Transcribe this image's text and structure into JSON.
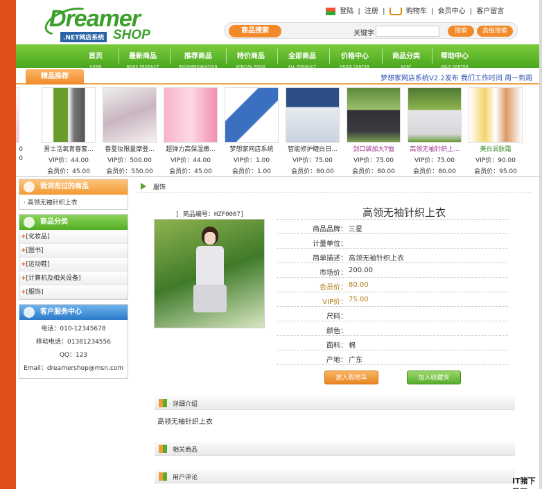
{
  "brand": {
    "main": "Dreamer",
    "sub1": ".NET网店系统",
    "sub2": "SHOP"
  },
  "toplinks": {
    "login": "登陆",
    "sep1": "|",
    "register": "注册",
    "sep2": "|",
    "cart": "购物车",
    "sep3": "|",
    "member": "会员中心",
    "sep4": "|",
    "guestbook": "客户留言"
  },
  "search": {
    "title": "商品搜索",
    "keyword_label": "关键字",
    "keyword_value": "",
    "search_btn": "搜索",
    "advanced_btn": "高级搜索"
  },
  "nav": [
    {
      "cn": "首页",
      "en": "HOME"
    },
    {
      "cn": "最新商品",
      "en": "NEWS PRODUCT"
    },
    {
      "cn": "推荐商品",
      "en": "RECOMMENDATION"
    },
    {
      "cn": "特价商品",
      "en": "SPECIAL PRICE"
    },
    {
      "cn": "全部商品",
      "en": "ALL PRODUCT"
    },
    {
      "cn": "价格中心",
      "en": "PRICE CENTER"
    },
    {
      "cn": "商品分类",
      "en": "SORT"
    },
    {
      "cn": "帮助中心",
      "en": "HELP CENTER"
    }
  ],
  "recommend": {
    "tab": "精品推荐",
    "marquee": "梦想家网店系统V2.2发布    我们工作时间  周一到周"
  },
  "products": [
    {
      "name": "",
      "vip": "0",
      "mem": "0"
    },
    {
      "name": "男士活氧青春套...",
      "vip": "VIP价：44.00",
      "mem": "会员价：45.00"
    },
    {
      "name": "春夏妆限量摩登...",
      "vip": "VIP价：500.00",
      "mem": "会员价：550.00"
    },
    {
      "name": "超弹力高保湿嫩...",
      "vip": "VIP价：44.00",
      "mem": "会员价：45.00"
    },
    {
      "name": "梦想家网店系统",
      "vip": "VIP价：1.00",
      "mem": "会员价：1.00"
    },
    {
      "name": "智能修护睫白日...",
      "vip": "VIP价：75.00",
      "mem": "会员价：80.00"
    },
    {
      "name": "剑口袋加大T恤",
      "vip": "VIP价：75.00",
      "mem": "会员价：80.00"
    },
    {
      "name": "高领无袖针织上...",
      "vip": "VIP价：75.00",
      "mem": "会员价：80.00"
    },
    {
      "name": "美白润肤霜",
      "vip": "VIP价：90.00",
      "mem": "会员价：95.00"
    }
  ],
  "sidebar": {
    "viewed_title": "我浏览过的商品",
    "viewed_item": "· 高领无袖针织上衣",
    "cat_title": "商品分类",
    "cats": [
      "[化妆品]",
      "[图书]",
      "[运动鞋]",
      "[计算机及相关设备]",
      "[服饰]"
    ],
    "cat_plus": "+",
    "svc_title": "客户服务中心",
    "phone": "电话：010-12345678",
    "mobile": "移动电话：01381234556",
    "qq": "QQ：123",
    "email": "Email：dreamershop@msn.com"
  },
  "breadcrumb": "服饰",
  "product": {
    "code": "[ 商品编号：HZF0007]",
    "title": "高领无袖针织上衣",
    "attrs": [
      {
        "k": "商品品牌：",
        "v": "三星"
      },
      {
        "k": "计量单位：",
        "v": ""
      },
      {
        "k": "简单描述：",
        "v": "高领无袖针织上衣"
      },
      {
        "k": "市场价：",
        "v": "200.00"
      },
      {
        "k": "会员价：",
        "v": "80.00"
      },
      {
        "k": "VIP价：",
        "v": "75.00"
      },
      {
        "k": "尺码：",
        "v": ""
      },
      {
        "k": "颜色：",
        "v": ""
      },
      {
        "k": "面料：",
        "v": "棉"
      },
      {
        "k": "产地：",
        "v": "广东"
      }
    ],
    "add_cart": "放入购物车",
    "add_fav": "加入收藏夹"
  },
  "sections": {
    "detail": "详细介绍",
    "detail_text": "高领无袖针织上衣",
    "related": "相关商品",
    "comments": "用户评论"
  },
  "watermark": "IT猪下载网",
  "colors": {
    "accent_orange": "#e1501c",
    "nav_green": "#4aa71f"
  }
}
